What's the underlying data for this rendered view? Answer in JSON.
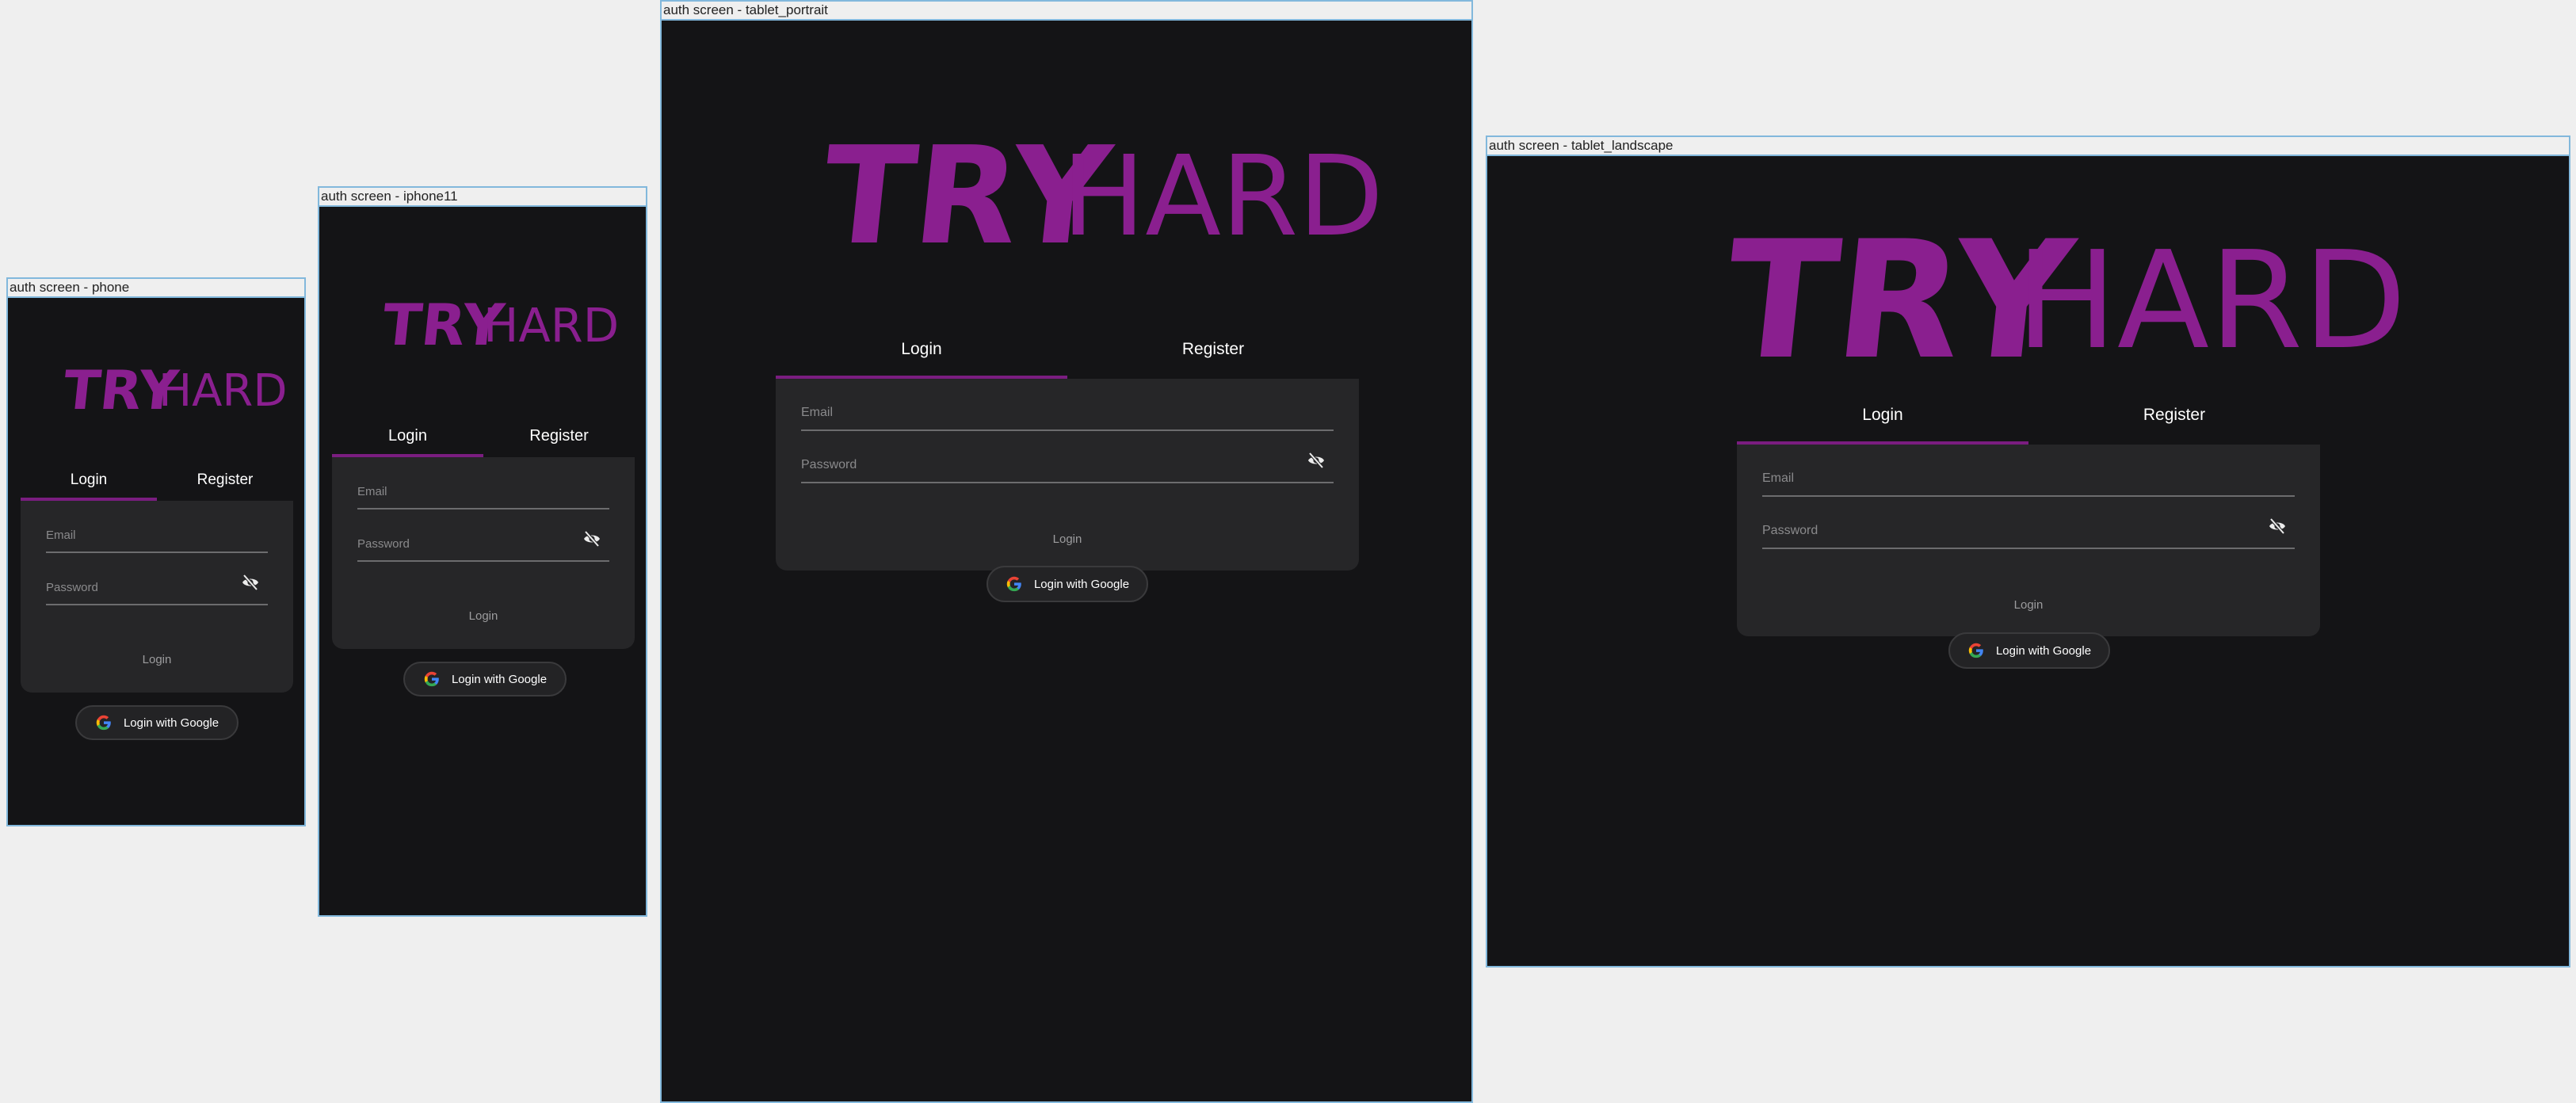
{
  "phone": {
    "frame_label": "auth screen - phone",
    "logo": {
      "left": "TRY",
      "right": "HARD"
    },
    "tabs": {
      "login": "Login",
      "register": "Register"
    },
    "form": {
      "email_placeholder": "Email",
      "password_placeholder": "Password",
      "submit": "Login"
    },
    "google_button": "Login with Google"
  },
  "iphone11": {
    "frame_label": "auth screen - iphone11",
    "logo": {
      "left": "TRY",
      "right": "HARD"
    },
    "tabs": {
      "login": "Login",
      "register": "Register"
    },
    "form": {
      "email_placeholder": "Email",
      "password_placeholder": "Password",
      "submit": "Login"
    },
    "google_button": "Login with Google"
  },
  "tablet_portrait": {
    "frame_label": "auth screen - tablet_portrait",
    "logo": {
      "left": "TRY",
      "right": "HARD"
    },
    "tabs": {
      "login": "Login",
      "register": "Register"
    },
    "form": {
      "email_placeholder": "Email",
      "password_placeholder": "Password",
      "submit": "Login"
    },
    "google_button": "Login with Google"
  },
  "tablet_landscape": {
    "frame_label": "auth screen - tablet_landscape",
    "logo": {
      "left": "TRY",
      "right": "HARD"
    },
    "tabs": {
      "login": "Login",
      "register": "Register"
    },
    "form": {
      "email_placeholder": "Email",
      "password_placeholder": "Password",
      "submit": "Login"
    },
    "google_button": "Login with Google"
  },
  "colors": {
    "background": "#141416",
    "card": "#262628",
    "brand_purple": "#8a1f8f",
    "tab_indicator": "#7a1d80",
    "frame_border": "#82b8dc",
    "canvas": "#efefef"
  },
  "icons": {
    "visibility_toggle": "eye-off-icon",
    "google": "google-g-icon"
  }
}
